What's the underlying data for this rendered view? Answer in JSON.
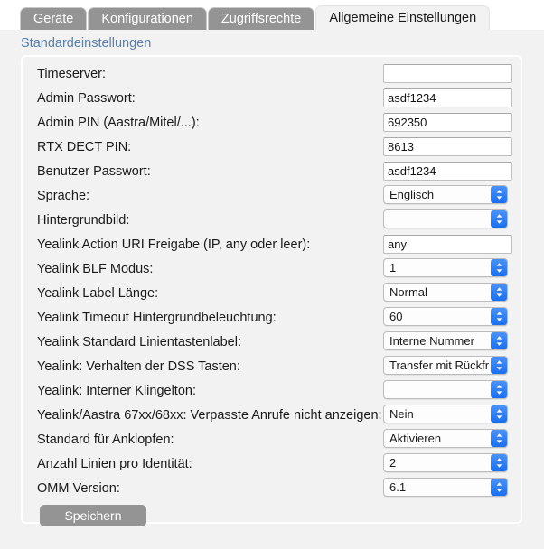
{
  "tabs": [
    {
      "label": "Geräte",
      "active": false
    },
    {
      "label": "Konfigurationen",
      "active": false
    },
    {
      "label": "Zugriffsrechte",
      "active": false
    },
    {
      "label": "Allgemeine Einstellungen",
      "active": true
    }
  ],
  "section": {
    "title": "Standardeinstellungen",
    "title_color": "#5b7fa6"
  },
  "fields": [
    {
      "label": "Timeserver:",
      "type": "text",
      "value": ""
    },
    {
      "label": "Admin Passwort:",
      "type": "text",
      "value": "asdf1234"
    },
    {
      "label": "Admin PIN (Aastra/Mitel/...):",
      "type": "text",
      "value": "692350"
    },
    {
      "label": "RTX DECT PIN:",
      "type": "text",
      "value": "8613"
    },
    {
      "label": "Benutzer Passwort:",
      "type": "text",
      "value": "asdf1234"
    },
    {
      "label": "Sprache:",
      "type": "select",
      "value": "Englisch"
    },
    {
      "label": "Hintergrundbild:",
      "type": "select",
      "value": ""
    },
    {
      "label": "Yealink Action URI Freigabe (IP, any oder leer):",
      "type": "text",
      "value": "any"
    },
    {
      "label": "Yealink BLF Modus:",
      "type": "select",
      "value": "1"
    },
    {
      "label": "Yealink Label Länge:",
      "type": "select",
      "value": "Normal"
    },
    {
      "label": "Yealink Timeout Hintergrundbeleuchtung:",
      "type": "select",
      "value": "60"
    },
    {
      "label": "Yealink Standard Linientastenlabel:",
      "type": "select",
      "value": "Interne Nummer"
    },
    {
      "label": "Yealink: Verhalten der DSS Tasten:",
      "type": "select",
      "value": "Transfer mit Rückfr"
    },
    {
      "label": "Yealink: Interner Klingelton:",
      "type": "select",
      "value": ""
    },
    {
      "label": "Yealink/Aastra 67xx/68xx: Verpasste Anrufe nicht anzeigen:",
      "type": "select",
      "value": "Nein"
    },
    {
      "label": "Standard für Anklopfen:",
      "type": "select",
      "value": "Aktivieren"
    },
    {
      "label": "Anzahl Linien pro Identität:",
      "type": "select",
      "value": "2"
    },
    {
      "label": "OMM Version:",
      "type": "select",
      "value": "6.1"
    }
  ],
  "actions": {
    "save_label": "Speichern"
  },
  "colors": {
    "tab_inactive_bg": "#949494",
    "tab_active_bg": "#f2f2f2",
    "page_bg": "#f2f2f2",
    "stepper_blue": "#2b7bf3",
    "button_bg": "#949494"
  }
}
